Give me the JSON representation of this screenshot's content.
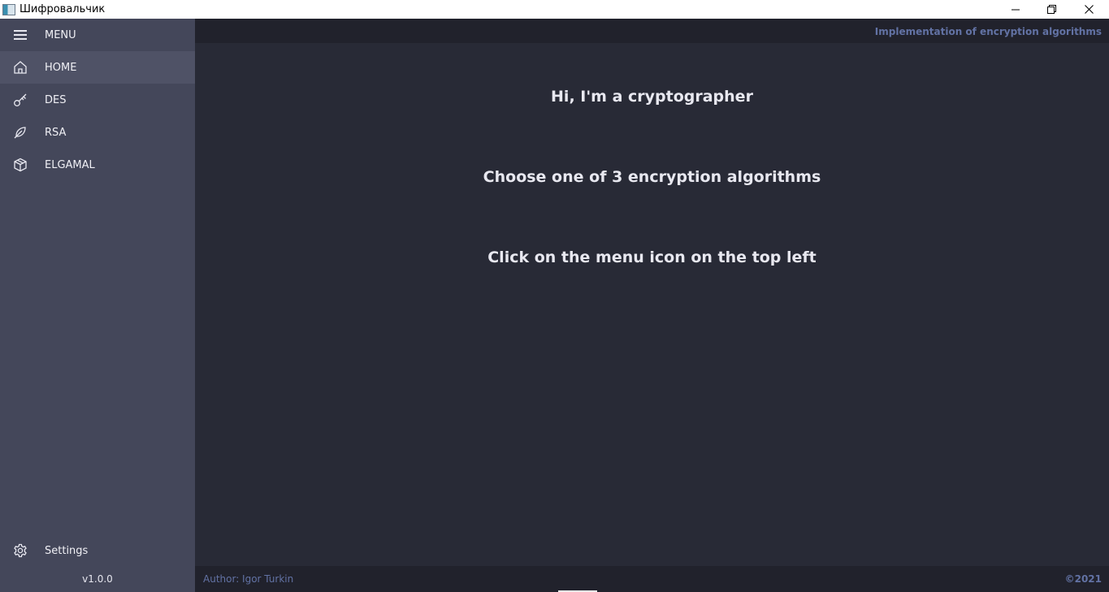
{
  "window": {
    "title": "Шифровальчик",
    "icons": {
      "app": "app-window-icon",
      "minimize": "minimize-icon",
      "restore": "restore-icon",
      "close": "close-icon"
    }
  },
  "sidebar": {
    "menu_toggle": {
      "label": "MENU",
      "icon": "hamburger-icon"
    },
    "items": [
      {
        "label": "HOME",
        "icon": "home-icon",
        "active": true
      },
      {
        "label": "DES",
        "icon": "key-icon",
        "active": false
      },
      {
        "label": "RSA",
        "icon": "feather-icon",
        "active": false
      },
      {
        "label": "ELGAMAL",
        "icon": "cube-icon",
        "active": false
      }
    ],
    "settings": {
      "label": "Settings",
      "icon": "gear-icon"
    },
    "version": "v1.0.0"
  },
  "header": {
    "subtitle": "Implementation of encryption algorithms"
  },
  "main": {
    "lines": [
      "Hi, I'm a cryptographer",
      "Choose one of 3 encryption algorithms",
      "Click on the menu icon on the top left"
    ]
  },
  "footer": {
    "author": "Author: Igor Turkin",
    "copyright": "©2021"
  },
  "colors": {
    "sidebar_bg": "#44475a",
    "sidebar_active": "#4f5266",
    "content_bg": "#282a36",
    "bar_bg": "#21222c",
    "accent": "#6272a4",
    "text": "#e8e8f0"
  }
}
